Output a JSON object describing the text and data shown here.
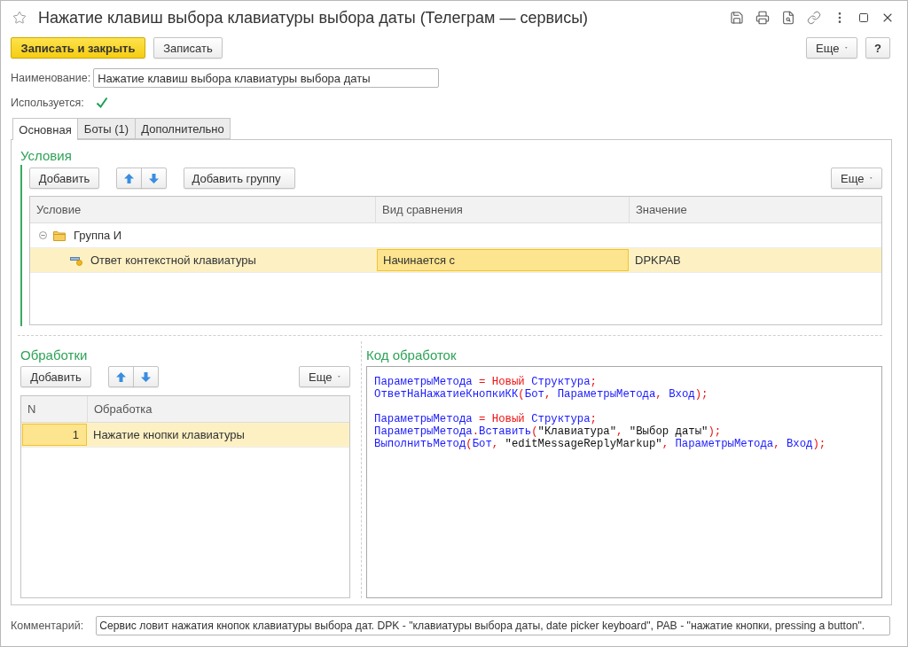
{
  "window": {
    "title": "Нажатие клавиш выбора клавиатуры выбора даты (Телеграм — сервисы)"
  },
  "toolbar": {
    "buttons": [
      {
        "label": "Записать и закрыть",
        "kind": "primary"
      },
      {
        "label": "Записать",
        "kind": "default"
      }
    ],
    "more_button": "Еще",
    "help_button": "?"
  },
  "name_field": {
    "label": "Наименование:",
    "value": "Нажатие клавиш выбора клавиатуры выбора даты"
  },
  "used_checkbox": {
    "label": "Используется:",
    "checked": true
  },
  "tabs": [
    {
      "label": "Основная",
      "selected": true
    },
    {
      "label": "Боты (1)",
      "selected": false
    },
    {
      "label": "Дополнительно",
      "selected": false
    }
  ],
  "conditions": {
    "title": "Условия",
    "add_button": "Добавить",
    "add_group_button": "Добавить группу",
    "more_button": "Еще",
    "columns": [
      "Условие",
      "Вид сравнения",
      "Значение"
    ],
    "rows": [
      {
        "kind": "group",
        "expanded": true,
        "selected": false,
        "cells": [
          {
            "text": "Группа И",
            "focused": false
          }
        ],
        "children": [
          {
            "kind": "condition",
            "selected": true,
            "cells": [
              {
                "text": "Ответ контекстной клавиатуры",
                "focused": false
              },
              {
                "text": "Начинается с",
                "focused": true
              },
              {
                "text": "DPKPAB",
                "focused": false
              }
            ]
          }
        ]
      }
    ]
  },
  "handlers": {
    "title": "Обработки",
    "add_button": "Добавить",
    "more_button": "Еще",
    "columns": [
      "N",
      "Обработка"
    ],
    "rows": [
      {
        "selected": true,
        "cells": [
          {
            "text": "1",
            "focused": true
          },
          {
            "text": "Нажатие кнопки клавиатуры",
            "focused": false
          }
        ]
      }
    ]
  },
  "code": {
    "title": "Код обработок",
    "lines": [
      {
        "kind": "code",
        "tokens": [
          {
            "kind": "ident",
            "text": "ПараметрыМетода"
          },
          {
            "kind": "op",
            "text": " = "
          },
          {
            "kind": "keyword",
            "text": "Новый"
          },
          {
            "kind": "ident",
            "text": " Структура"
          },
          {
            "kind": "op",
            "text": ";"
          }
        ]
      },
      {
        "kind": "code",
        "tokens": [
          {
            "kind": "ident",
            "text": "ОтветНаНажатиеКнопкиКК"
          },
          {
            "kind": "op",
            "text": "("
          },
          {
            "kind": "ident",
            "text": "Бот"
          },
          {
            "kind": "op",
            "text": ", "
          },
          {
            "kind": "ident",
            "text": "ПараметрыМетода"
          },
          {
            "kind": "op",
            "text": ", "
          },
          {
            "kind": "ident",
            "text": "Вход"
          },
          {
            "kind": "op",
            "text": ");"
          }
        ]
      },
      {
        "kind": "blank"
      },
      {
        "kind": "code",
        "tokens": [
          {
            "kind": "ident",
            "text": "ПараметрыМетода"
          },
          {
            "kind": "op",
            "text": " = "
          },
          {
            "kind": "keyword",
            "text": "Новый"
          },
          {
            "kind": "ident",
            "text": " Структура"
          },
          {
            "kind": "op",
            "text": ";"
          }
        ]
      },
      {
        "kind": "code",
        "tokens": [
          {
            "kind": "ident",
            "text": "ПараметрыМетода"
          },
          {
            "kind": "op",
            "text": "."
          },
          {
            "kind": "ident",
            "text": "Вставить"
          },
          {
            "kind": "op",
            "text": "("
          },
          {
            "kind": "string",
            "text": "\"Клавиатура\""
          },
          {
            "kind": "op",
            "text": ", "
          },
          {
            "kind": "string",
            "text": "\"Выбор даты\""
          },
          {
            "kind": "op",
            "text": ");"
          }
        ]
      },
      {
        "kind": "code",
        "tokens": [
          {
            "kind": "ident",
            "text": "ВыполнитьМетод"
          },
          {
            "kind": "op",
            "text": "("
          },
          {
            "kind": "ident",
            "text": "Бот"
          },
          {
            "kind": "op",
            "text": ", "
          },
          {
            "kind": "string",
            "text": "\"editMessageReplyMarkup\""
          },
          {
            "kind": "op",
            "text": ", "
          },
          {
            "kind": "ident",
            "text": "ПараметрыМетода"
          },
          {
            "kind": "op",
            "text": ", "
          },
          {
            "kind": "ident",
            "text": "Вход"
          },
          {
            "kind": "op",
            "text": ");"
          }
        ]
      }
    ]
  },
  "comment": {
    "label": "Комментарий:",
    "value": "Сервис ловит нажатия кнопок клавиатуры выбора дат. DPK - \"клавиатуры выбора даты, date picker keyboard\", PAB - \"нажатие кнопки, pressing a button\"."
  }
}
